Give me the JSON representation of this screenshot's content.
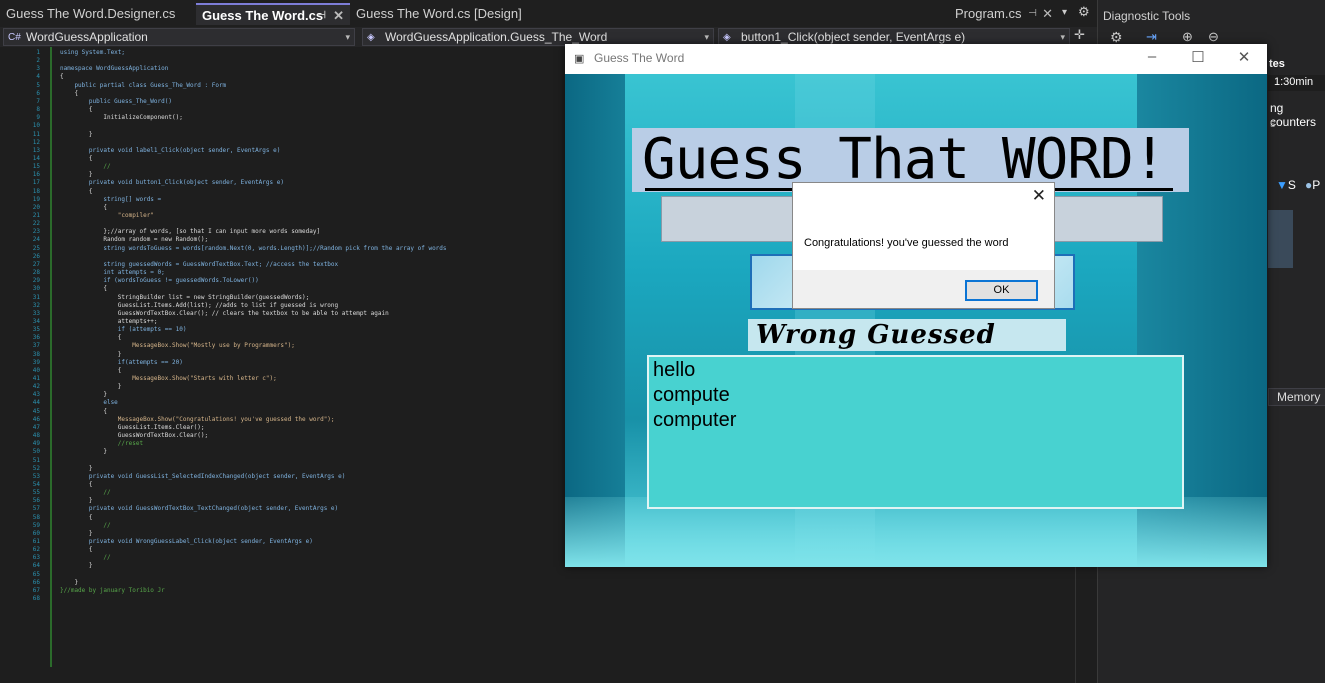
{
  "tabs": [
    {
      "label": "Guess The Word.Designer.cs",
      "active": false
    },
    {
      "label": "Guess The Word.cs",
      "active": true
    },
    {
      "label": "Guess The Word.cs [Design]",
      "active": false
    },
    {
      "label": "Program.cs",
      "active": false
    }
  ],
  "navbar": {
    "project": "WordGuessApplication",
    "class": "WordGuessApplication.Guess_The_Word",
    "member": "button1_Click(object sender, EventArgs e)"
  },
  "diagnostic_tools": {
    "title": "Diagnostic Tools",
    "time_label": "1:30min",
    "fragment1": "tes",
    "fragment2": "ng counters",
    "fragment3": "s",
    "memory_tab": "Memory",
    "legend_s": "S",
    "legend_p": "P"
  },
  "code": {
    "line_numbers": [
      "1",
      "2",
      "3",
      "4",
      "5",
      "6",
      "7",
      "8",
      "9",
      "10",
      "11",
      "12",
      "13",
      "14",
      "15",
      "16",
      "17",
      "18",
      "19",
      "20",
      "21",
      "22",
      "23",
      "24",
      "25",
      "26",
      "27",
      "28",
      "29",
      "30",
      "31",
      "32",
      "33",
      "34",
      "35",
      "36",
      "37",
      "38",
      "39",
      "40",
      "41",
      "42",
      "43",
      "44",
      "45",
      "46",
      "47",
      "48",
      "49",
      "50",
      "51",
      "52",
      "53",
      "54",
      "55",
      "56",
      "57",
      "58",
      "59",
      "60",
      "61",
      "62",
      "63",
      "64",
      "65",
      "66",
      "67",
      "68"
    ],
    "lines": [
      "using System.Text;",
      "",
      "namespace WordGuessApplication",
      "{",
      "    public partial class Guess_The_Word : Form",
      "    {",
      "        public Guess_The_Word()",
      "        {",
      "            InitializeComponent();",
      "",
      "        }",
      "",
      "        private void label1_Click(object sender, EventArgs e)",
      "        {",
      "            //",
      "        }",
      "        private void button1_Click(object sender, EventArgs e)",
      "        {",
      "            string[] words =",
      "            {",
      "                \"compiler\"",
      "",
      "            };//array of words, [so that I can input more words someday]",
      "            Random random = new Random();",
      "            string wordsToGuess = words[random.Next(0, words.Length)];//Random pick from the array of words",
      "",
      "            string guessedWords = GuessWordTextBox.Text; //access the textbox",
      "            int attempts = 0;",
      "            if (wordsToGuess != guessedWords.ToLower())",
      "            {",
      "                StringBuilder list = new StringBuilder(guessedWords);",
      "                GuessList.Items.Add(list); //adds to list if guessed is wrong",
      "                GuessWordTextBox.Clear(); // clears the textbox to be able to attempt again",
      "                attempts++;",
      "                if (attempts == 10)",
      "                {",
      "                    MessageBox.Show(\"Mostly use by Programmers\");",
      "                }",
      "                if(attempts == 20)",
      "                {",
      "                    MessageBox.Show(\"Starts with letter c\");",
      "                }",
      "            }",
      "            else",
      "            {",
      "                MessageBox.Show(\"Congratulations! you've guessed the word\");",
      "                GuessList.Items.Clear();",
      "                GuessWordTextBox.Clear();",
      "                //reset",
      "            }",
      "",
      "        }",
      "        private void GuessList_SelectedIndexChanged(object sender, EventArgs e)",
      "        {",
      "            //",
      "        }",
      "        private void GuessWordTextBox_TextChanged(object sender, EventArgs e)",
      "        {",
      "            //",
      "        }",
      "        private void WrongGuessLabel_Click(object sender, EventArgs e)",
      "        {",
      "            //",
      "        }",
      "",
      "    }",
      "}//made by january Toribio Jr",
      ""
    ]
  },
  "form": {
    "title": "Guess The Word",
    "heading": "Guess That WORD!",
    "wrong_label": "Wrong Guessed Words",
    "guess_list": [
      "hello",
      "compute",
      "computer"
    ]
  },
  "dialog": {
    "message": "Congratulations! you've guessed the word",
    "ok_label": "OK"
  }
}
